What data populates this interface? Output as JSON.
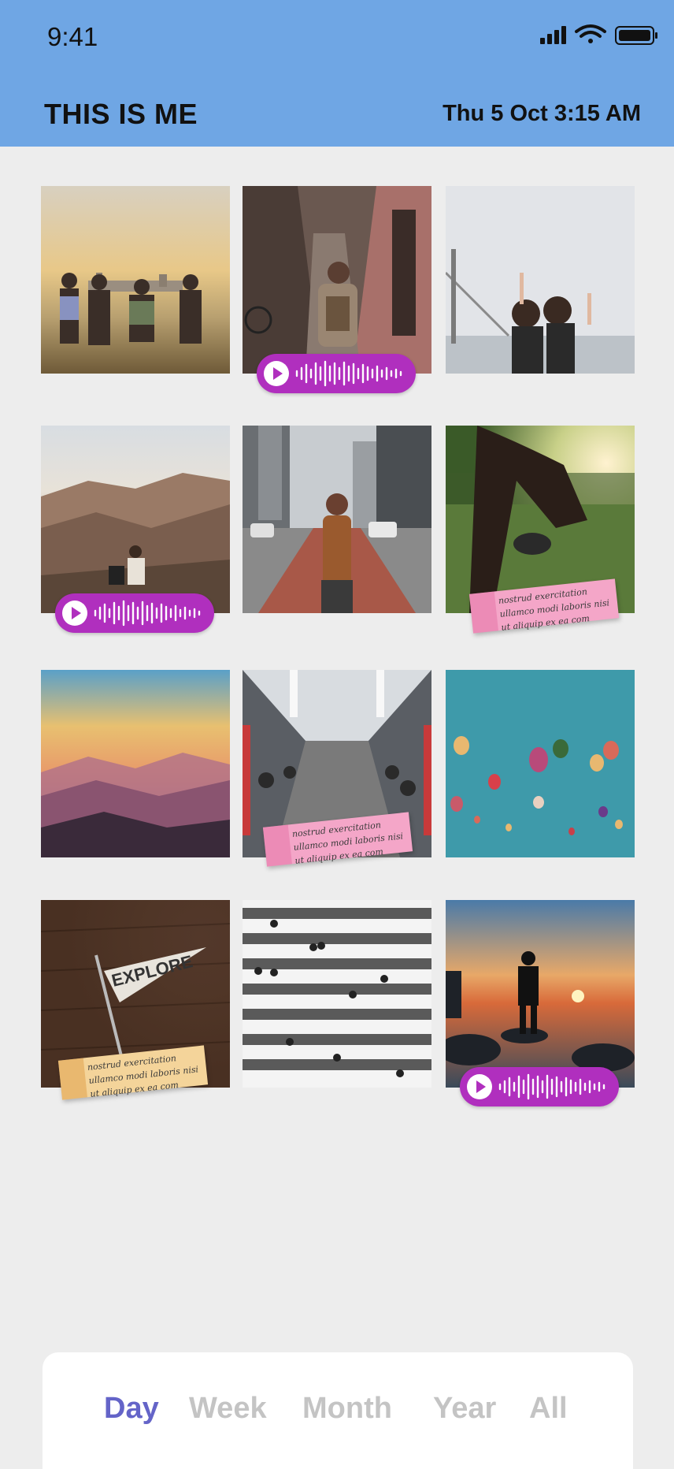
{
  "status_bar": {
    "time": "9:41"
  },
  "header": {
    "brand": "THIS IS ME",
    "datetime": "Thu 5 Oct 3:15 AM",
    "brand_accent": "#d33b3b",
    "background": "#6fa6e4"
  },
  "notes": {
    "text": "nostrud exercitation ullamco modi laboris nisi ut aliquip ex ea com"
  },
  "colors": {
    "audio_pill": "#b02fbe",
    "note_pink": "#f4a6c8",
    "note_yellow": "#f4d49a",
    "tab_active": "#6464c8",
    "tab_inactive": "#c4c4c4"
  },
  "tabs": [
    {
      "label": "Day",
      "active": true
    },
    {
      "label": "Week",
      "active": false
    },
    {
      "label": "Month",
      "active": false
    },
    {
      "label": "Year",
      "active": false
    },
    {
      "label": "All",
      "active": false
    }
  ]
}
